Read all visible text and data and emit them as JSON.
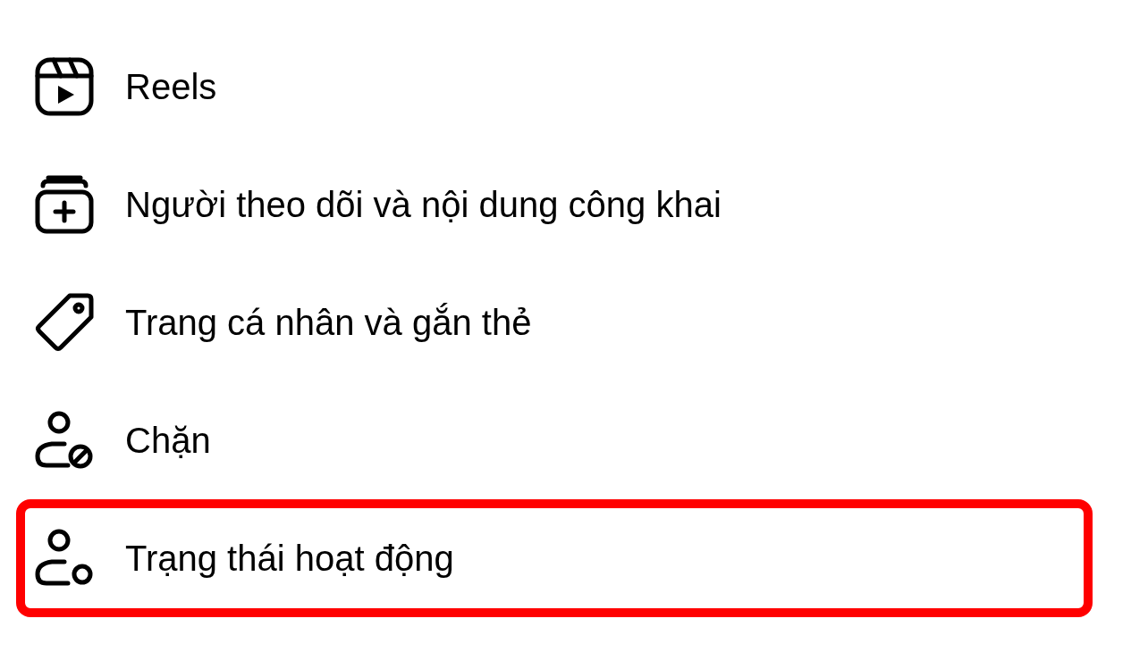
{
  "menu": {
    "items": [
      {
        "kind": "reels",
        "label": "Reels",
        "highlighted": false
      },
      {
        "kind": "followers",
        "label": "Người theo dõi và nội dung công khai",
        "highlighted": false
      },
      {
        "kind": "tag",
        "label": "Trang cá nhân và gắn thẻ",
        "highlighted": false
      },
      {
        "kind": "blocked",
        "label": "Chặn",
        "highlighted": false
      },
      {
        "kind": "status",
        "label": "Trạng thái hoạt động",
        "highlighted": true
      }
    ]
  }
}
